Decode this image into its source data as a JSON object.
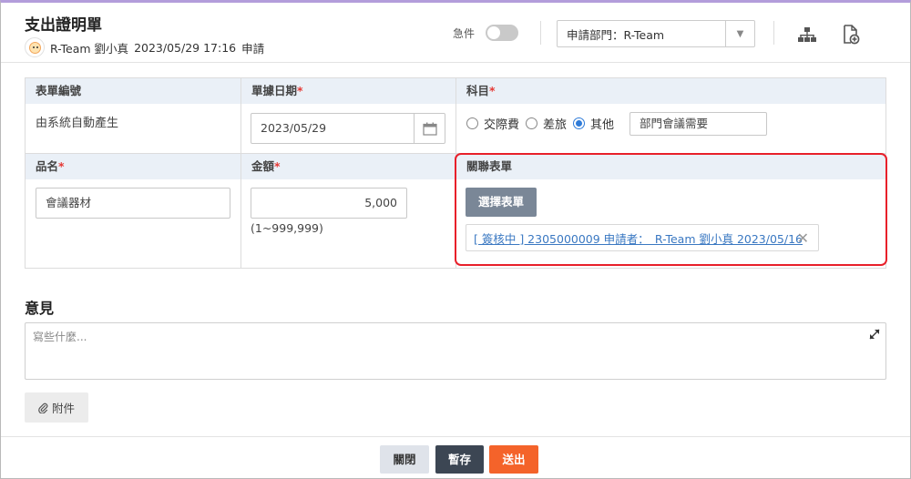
{
  "header": {
    "title": "支出證明單",
    "applicant": "R-Team 劉小真",
    "datetime": "2023/05/29 17:16",
    "action": "申請",
    "urgent_label": "急件",
    "department": "申請部門：R-Team",
    "icons": [
      "org-chart-icon",
      "add-document-icon"
    ]
  },
  "form": {
    "form_no_label": "表單編號",
    "form_no_value": "由系統自動產生",
    "date_label": "單據日期",
    "date_value": "2023/05/29",
    "subject_label": "科目",
    "subject_options": [
      "交際費",
      "差旅",
      "其他"
    ],
    "subject_selected": "其他",
    "subject_other_value": "部門會議需要",
    "item_label": "品名",
    "item_value": "會議器材",
    "amount_label": "金額",
    "amount_value": "5,000",
    "amount_hint": "(1~999,999)",
    "related_label": "關聯表單",
    "select_form_button": "選擇表單",
    "related_link": "[ 簽核中 ] 2305000009 申請者：　R-Team 劉小真 2023/05/16",
    "required_mark": "*"
  },
  "comments": {
    "title": "意見",
    "placeholder": "寫些什麼..."
  },
  "attach_label": "附件",
  "footer": {
    "close_label": "關閉",
    "draft_label": "暫存",
    "submit_label": "送出"
  },
  "colors": {
    "header_accent": "#b39ddb",
    "label_bg": "#eaf0f7",
    "required": "#e53935",
    "highlight_border": "#e8202a",
    "link": "#3a78c2",
    "draft_button": "#3c4653",
    "submit_button": "#f4632a"
  }
}
